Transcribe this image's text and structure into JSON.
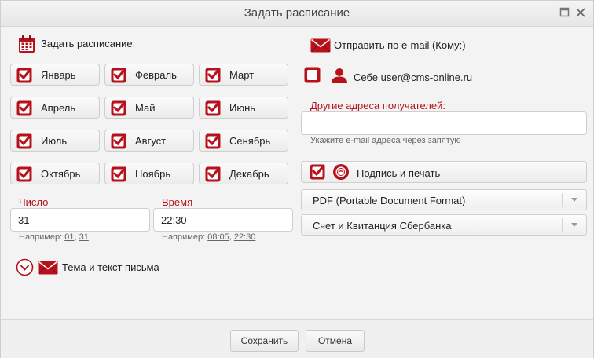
{
  "window": {
    "title": "Задать расписание"
  },
  "schedule": {
    "label": "Задать расписание:",
    "months": [
      {
        "label": "Январь",
        "checked": true
      },
      {
        "label": "Февраль",
        "checked": true
      },
      {
        "label": "Март",
        "checked": true
      },
      {
        "label": "Апрель",
        "checked": true
      },
      {
        "label": "Май",
        "checked": true
      },
      {
        "label": "Июнь",
        "checked": true
      },
      {
        "label": "Июль",
        "checked": true
      },
      {
        "label": "Август",
        "checked": true
      },
      {
        "label": "Сенябрь",
        "checked": true
      },
      {
        "label": "Октябрь",
        "checked": true
      },
      {
        "label": "Ноябрь",
        "checked": true
      },
      {
        "label": "Декабрь",
        "checked": true
      }
    ],
    "day": {
      "label": "Число",
      "value": "31",
      "hint_prefix": "Например:",
      "examples": [
        "01",
        "31"
      ]
    },
    "time": {
      "label": "Время",
      "value": "22:30",
      "hint_prefix": "Например:",
      "examples": [
        "08:05",
        "22:30"
      ]
    },
    "letter_toggle_label": "Тема и текст письма"
  },
  "email": {
    "label": "Отправить по e-mail (Кому:)",
    "self": {
      "label": "Себе user@cms-online.ru",
      "checked": false
    },
    "other": {
      "label": "Другие адреса получателей:",
      "value": "",
      "hint": "Укажите e-mail адреса через запятую"
    },
    "sign": {
      "label": "Подпись и печать",
      "checked": true
    },
    "format_select": {
      "value": "PDF (Portable Document Format)"
    },
    "doc_select": {
      "value": "Счет и Квитанция Сбербанка"
    }
  },
  "footer": {
    "save_label": "Сохранить",
    "cancel_label": "Отмена"
  },
  "colors": {
    "accent": "#b5121b",
    "background": "#f3f3f3",
    "border": "#cfcfcf"
  }
}
